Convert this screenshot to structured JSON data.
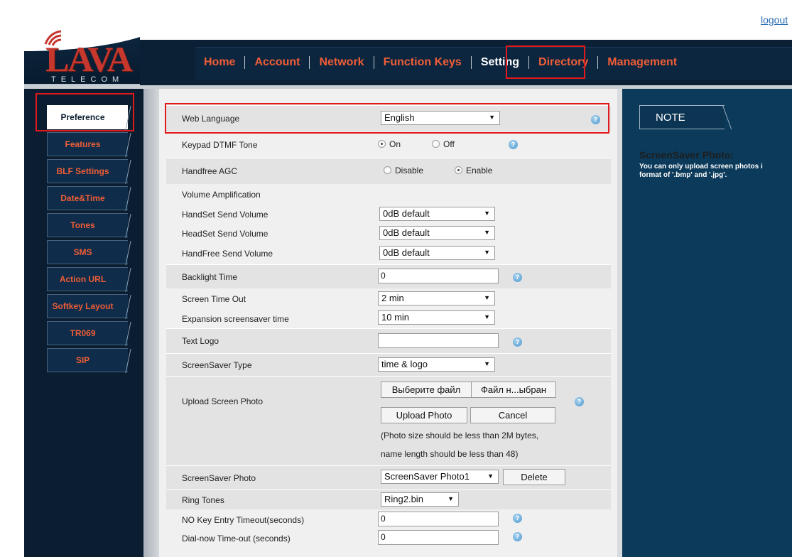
{
  "header": {
    "logout": "logout",
    "logo_main": "LAVA",
    "logo_sub": "TELECOM",
    "nav": [
      "Home",
      "Account",
      "Network",
      "Function Keys",
      "Setting",
      "Directory",
      "Management"
    ],
    "active_nav": "Setting"
  },
  "sidebar": {
    "items": [
      "Preference",
      "Features",
      "BLF Settings",
      "Date&Time",
      "Tones",
      "SMS",
      "Action URL",
      "Softkey Layout",
      "TR069",
      "SIP"
    ],
    "active": "Preference"
  },
  "form": {
    "web_language": {
      "label": "Web Language",
      "value": "English"
    },
    "keypad_dtmf": {
      "label": "Keypad DTMF Tone",
      "on": "On",
      "off": "Off",
      "selected": "On"
    },
    "handfree_agc": {
      "label": "Handfree AGC",
      "disable": "Disable",
      "enable": "Enable",
      "selected": "Enable"
    },
    "volume_amplification": {
      "label": "Volume Amplification"
    },
    "handset_send_volume": {
      "label": "HandSet Send Volume",
      "value": "0dB default"
    },
    "headset_send_volume": {
      "label": "HeadSet Send Volume",
      "value": "0dB default"
    },
    "handfree_send_volume": {
      "label": "HandFree Send Volume",
      "value": "0dB default"
    },
    "backlight_time": {
      "label": "Backlight Time",
      "value": "0"
    },
    "screen_time_out": {
      "label": "Screen Time Out",
      "value": "2 min"
    },
    "expansion_saver": {
      "label": "Expansion screensaver time",
      "value": "10 min"
    },
    "text_logo": {
      "label": "Text Logo",
      "value": ""
    },
    "screensaver_type": {
      "label": "ScreenSaver Type",
      "value": "time & logo"
    },
    "upload_screen_photo": {
      "label": "Upload Screen Photo",
      "choose_file": "Выберите файл",
      "file_status": "Файл н...ыбран",
      "upload_button": "Upload Photo",
      "cancel_button": "Cancel",
      "hint1": "(Photo size should be less than 2M bytes,",
      "hint2": "name length should be less than 48)"
    },
    "screensaver_photo": {
      "label": "ScreenSaver Photo",
      "value": "ScreenSaver Photo1",
      "delete_button": "Delete"
    },
    "ring_tones": {
      "label": "Ring Tones",
      "value": "Ring2.bin"
    },
    "no_key_timeout": {
      "label": "NO Key Entry Timeout(seconds)",
      "value": "0"
    },
    "dial_now_timeout": {
      "label": "Dial-now Time-out (seconds)",
      "value": "0"
    }
  },
  "note": {
    "tab": "NOTE",
    "title": "ScreenSaver Photo:",
    "line1": "You can only upload screen photos i",
    "line2": "format of '.bmp' and '.jpg'."
  },
  "colors": {
    "nav_accent": "#ef5d36",
    "highlight_box": "#e2191b",
    "header_bg": "#0b2035",
    "note_bg": "#0b3a5a"
  }
}
